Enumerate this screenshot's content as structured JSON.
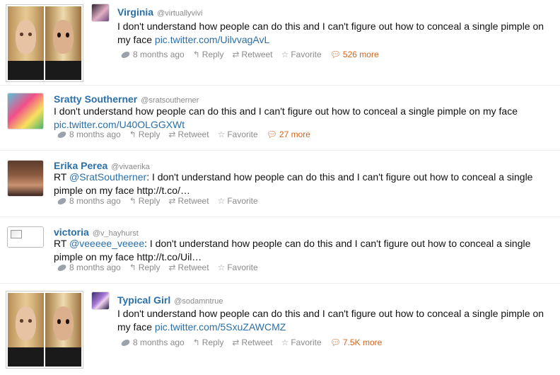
{
  "tweets": [
    {
      "name": "Virginia",
      "handle": "@virtuallyvivi",
      "text_line1": "I don't understand how people can do this and I can't figure out how to conceal a single pimple on",
      "text_line2_prefix": "my face ",
      "link": "pic.twitter.com/UilvvagAvL",
      "time": "8 months ago",
      "reply": "Reply",
      "retweet": "Retweet",
      "favorite": "Favorite",
      "more": "526 more"
    },
    {
      "name": "Sratty Southerner",
      "handle": "@sratsoutherner",
      "text_line1": "I don't understand how people can do this and I can't figure out how to conceal a single pimple on my face",
      "link": "pic.twitter.com/U40OLGGXWt",
      "time": "8 months ago",
      "reply": "Reply",
      "retweet": "Retweet",
      "favorite": "Favorite",
      "more": "27 more"
    },
    {
      "name": "Erika Perea",
      "handle": "@vivaerika",
      "text_prefix": "RT ",
      "mention": "@SratSoutherner",
      "text_rest": ": I don't understand how people can do this and I can't figure out how to conceal a single",
      "text_line2": "pimple on my face http://t.co/…",
      "time": "8 months ago",
      "reply": "Reply",
      "retweet": "Retweet",
      "favorite": "Favorite"
    },
    {
      "name": "victoria",
      "handle": "@v_hayhurst",
      "text_prefix": "RT ",
      "mention": "@veeeee_veeee",
      "text_rest": ": I don't understand how people can do this and I can't figure out how to conceal a single",
      "text_line2": "pimple on my face http://t.co/Uil…",
      "time": "8 months ago",
      "reply": "Reply",
      "retweet": "Retweet",
      "favorite": "Favorite"
    },
    {
      "name": "Typical Girl",
      "handle": "@sodamntrue",
      "text_line1": "I don't understand how people can do this and I can't figure out how to conceal a single pimple on",
      "text_line2_prefix": "my face ",
      "link": "pic.twitter.com/5SxuZAWCMZ",
      "time": "8 months ago",
      "reply": "Reply",
      "retweet": "Retweet",
      "favorite": "Favorite",
      "more": "7.5K more"
    }
  ],
  "icons": {
    "reply": "reply-arrow-icon",
    "retweet": "retweet-icon",
    "favorite": "star-icon",
    "more": "speech-bubble-icon",
    "time": "twitter-bird-icon"
  },
  "colors": {
    "link": "#2a6fa8",
    "more": "#d4641c",
    "meta": "#8a8a8a"
  }
}
